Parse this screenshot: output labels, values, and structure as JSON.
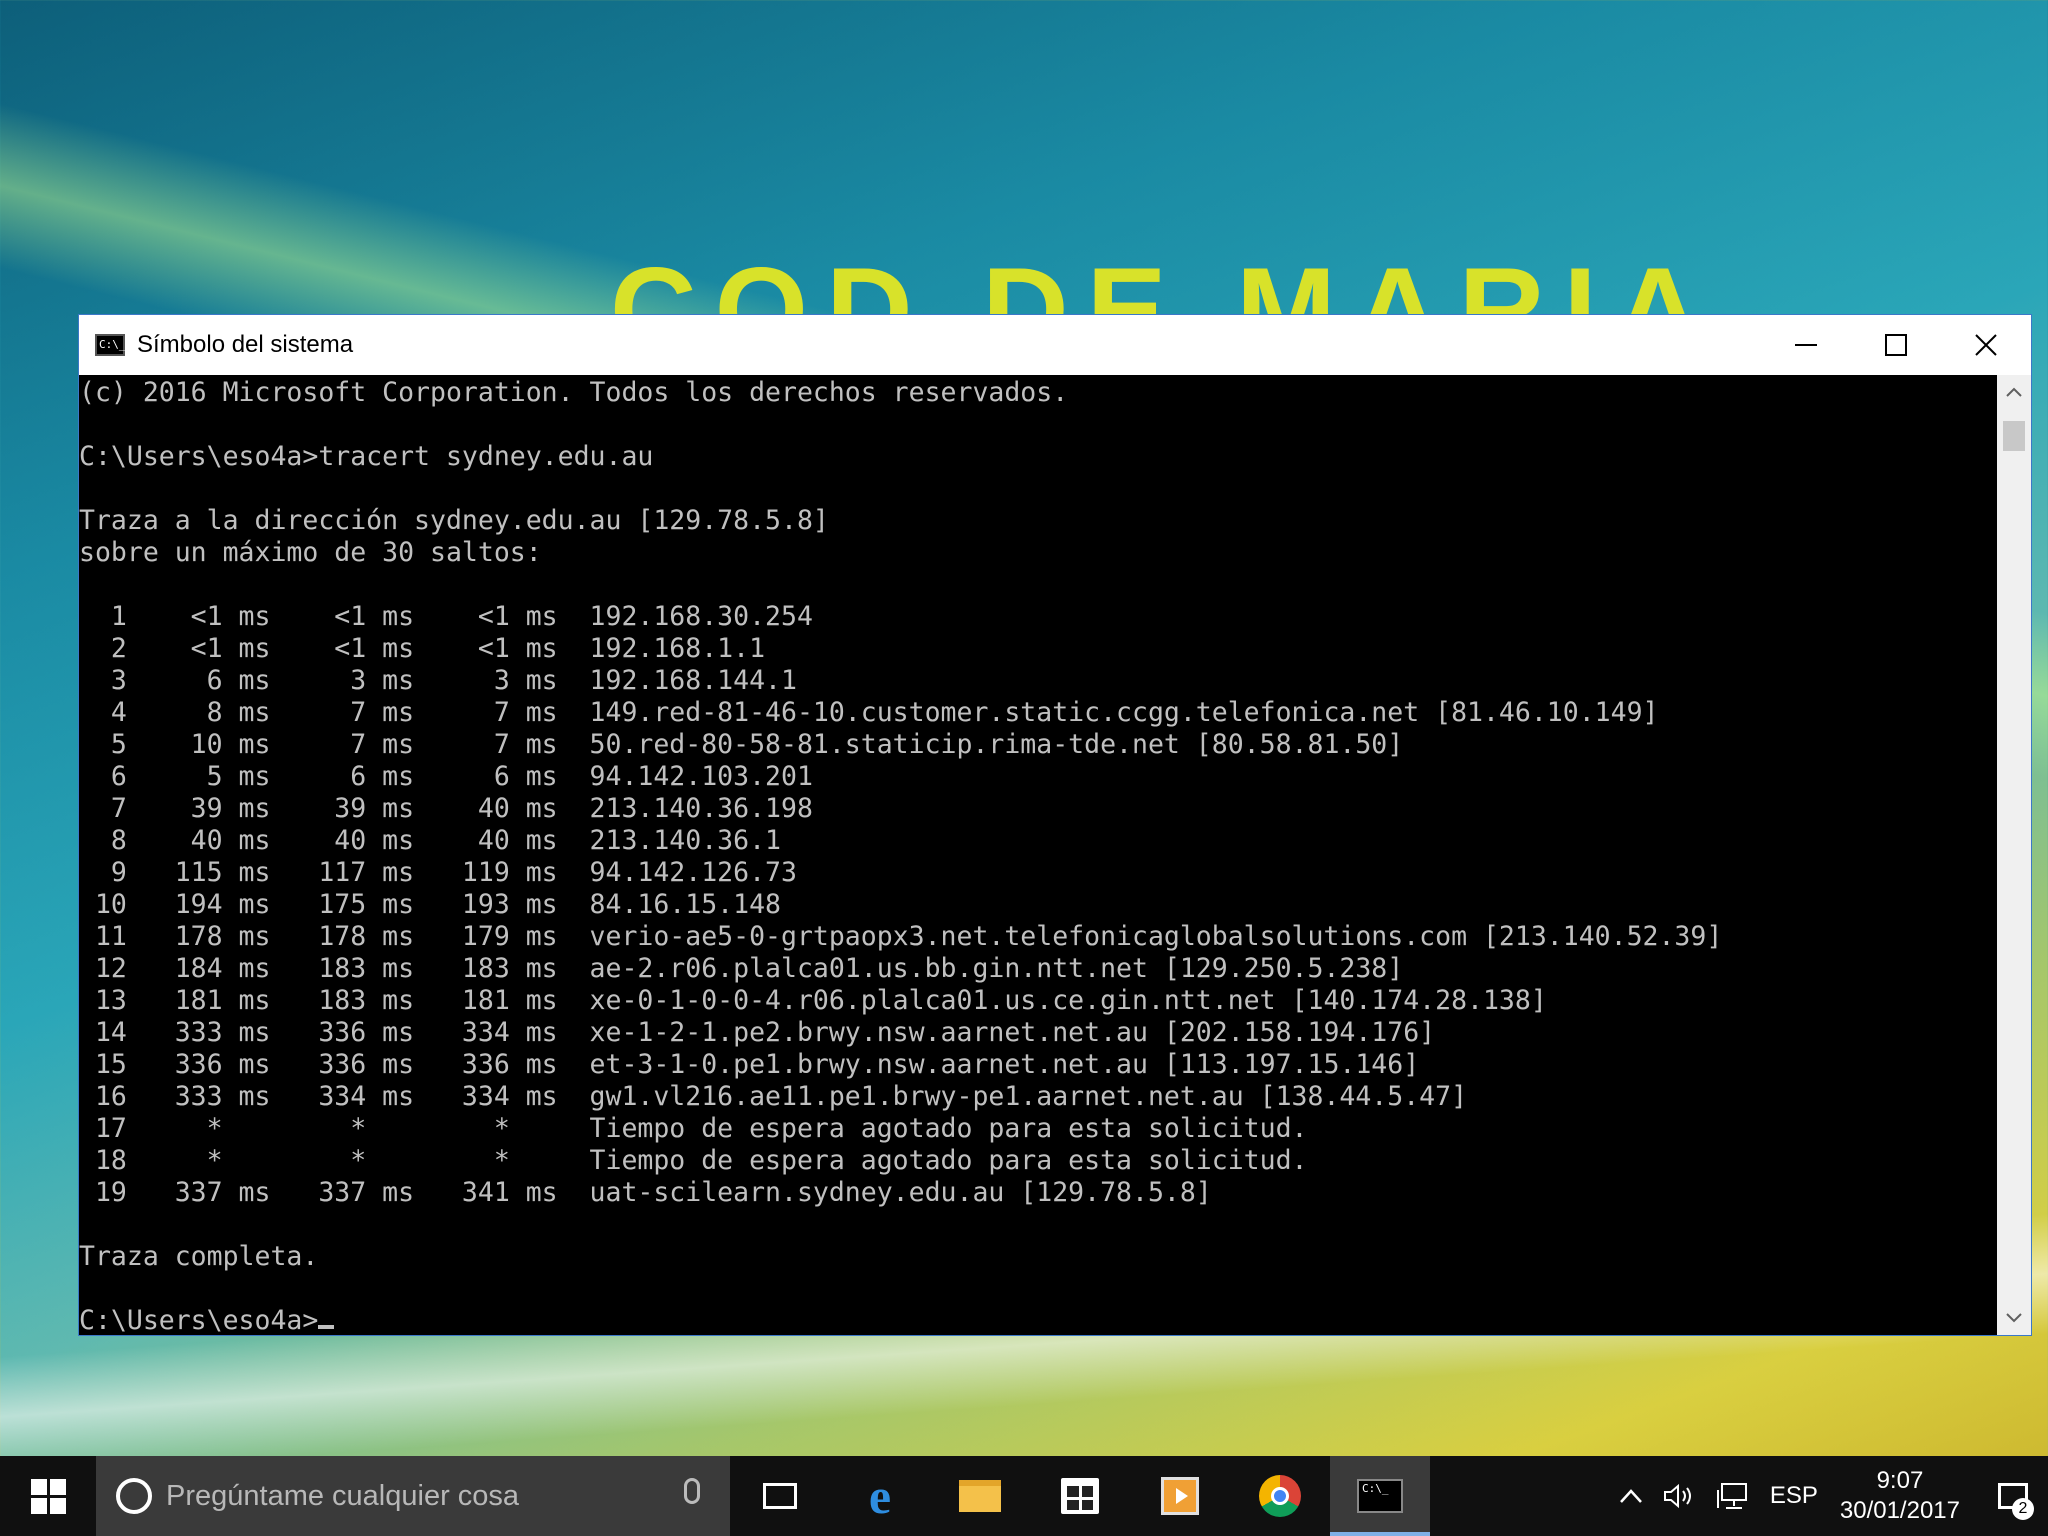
{
  "wallpaper": {
    "text": "COD DE MARIA"
  },
  "window": {
    "title": "Símbolo del sistema",
    "icon_label": "C:\\_"
  },
  "console": {
    "lines": [
      "(c) 2016 Microsoft Corporation. Todos los derechos reservados.",
      "",
      "C:\\Users\\eso4a>tracert sydney.edu.au",
      "",
      "Traza a la dirección sydney.edu.au [129.78.5.8]",
      "sobre un máximo de 30 saltos:",
      "",
      "  1    <1 ms    <1 ms    <1 ms  192.168.30.254",
      "  2    <1 ms    <1 ms    <1 ms  192.168.1.1",
      "  3     6 ms     3 ms     3 ms  192.168.144.1",
      "  4     8 ms     7 ms     7 ms  149.red-81-46-10.customer.static.ccgg.telefonica.net [81.46.10.149]",
      "  5    10 ms     7 ms     7 ms  50.red-80-58-81.staticip.rima-tde.net [80.58.81.50]",
      "  6     5 ms     6 ms     6 ms  94.142.103.201",
      "  7    39 ms    39 ms    40 ms  213.140.36.198",
      "  8    40 ms    40 ms    40 ms  213.140.36.1",
      "  9   115 ms   117 ms   119 ms  94.142.126.73",
      " 10   194 ms   175 ms   193 ms  84.16.15.148",
      " 11   178 ms   178 ms   179 ms  verio-ae5-0-grtpaopx3.net.telefonicaglobalsolutions.com [213.140.52.39]",
      " 12   184 ms   183 ms   183 ms  ae-2.r06.plalca01.us.bb.gin.ntt.net [129.250.5.238]",
      " 13   181 ms   183 ms   181 ms  xe-0-1-0-0-4.r06.plalca01.us.ce.gin.ntt.net [140.174.28.138]",
      " 14   333 ms   336 ms   334 ms  xe-1-2-1.pe2.brwy.nsw.aarnet.net.au [202.158.194.176]",
      " 15   336 ms   336 ms   336 ms  et-3-1-0.pe1.brwy.nsw.aarnet.net.au [113.197.15.146]",
      " 16   333 ms   334 ms   334 ms  gw1.vl216.ae11.pe1.brwy-pe1.aarnet.net.au [138.44.5.47]",
      " 17     *        *        *     Tiempo de espera agotado para esta solicitud.",
      " 18     *        *        *     Tiempo de espera agotado para esta solicitud.",
      " 19   337 ms   337 ms   341 ms  uat-scilearn.sydney.edu.au [129.78.5.8]",
      "",
      "Traza completa.",
      ""
    ],
    "prompt": "C:\\Users\\eso4a>"
  },
  "taskbar": {
    "search_placeholder": "Pregúntame cualquier cosa",
    "tray": {
      "language": "ESP",
      "time": "9:07",
      "date": "30/01/2017",
      "notification_count": "2"
    },
    "apps": [
      "task-view",
      "edge",
      "file-explorer",
      "store",
      "media-player",
      "chrome",
      "command-prompt"
    ]
  }
}
